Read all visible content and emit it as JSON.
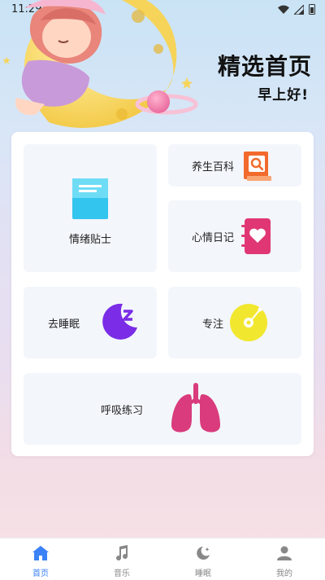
{
  "status": {
    "time": "11:29"
  },
  "header": {
    "title": "精选首页",
    "greeting": "早上好!"
  },
  "cards": {
    "emotion": {
      "label": "情绪贴士",
      "icon": "notepad-icon"
    },
    "health": {
      "label": "养生百科",
      "icon": "search-book-icon"
    },
    "diary": {
      "label": "心情日记",
      "icon": "heart-notebook-icon"
    },
    "sleep": {
      "label": "去睡眠",
      "icon": "moon-zz-icon"
    },
    "focus": {
      "label": "专注",
      "icon": "disc-icon"
    },
    "breath": {
      "label": "呼吸练习",
      "icon": "lungs-icon"
    }
  },
  "nav": {
    "items": [
      {
        "label": "首页",
        "icon": "home-icon",
        "active": true
      },
      {
        "label": "音乐",
        "icon": "music-note-icon",
        "active": false
      },
      {
        "label": "睡眠",
        "icon": "moon-star-icon",
        "active": false
      },
      {
        "label": "我的",
        "icon": "user-icon",
        "active": false
      }
    ]
  },
  "colors": {
    "accent": "#3b82f6",
    "notepad": "#34c5ee",
    "book": "#f26b2c",
    "diary": "#e03774",
    "moon": "#7a2ce6",
    "disc": "#f2e72f",
    "lungs": "#d93b7c"
  }
}
